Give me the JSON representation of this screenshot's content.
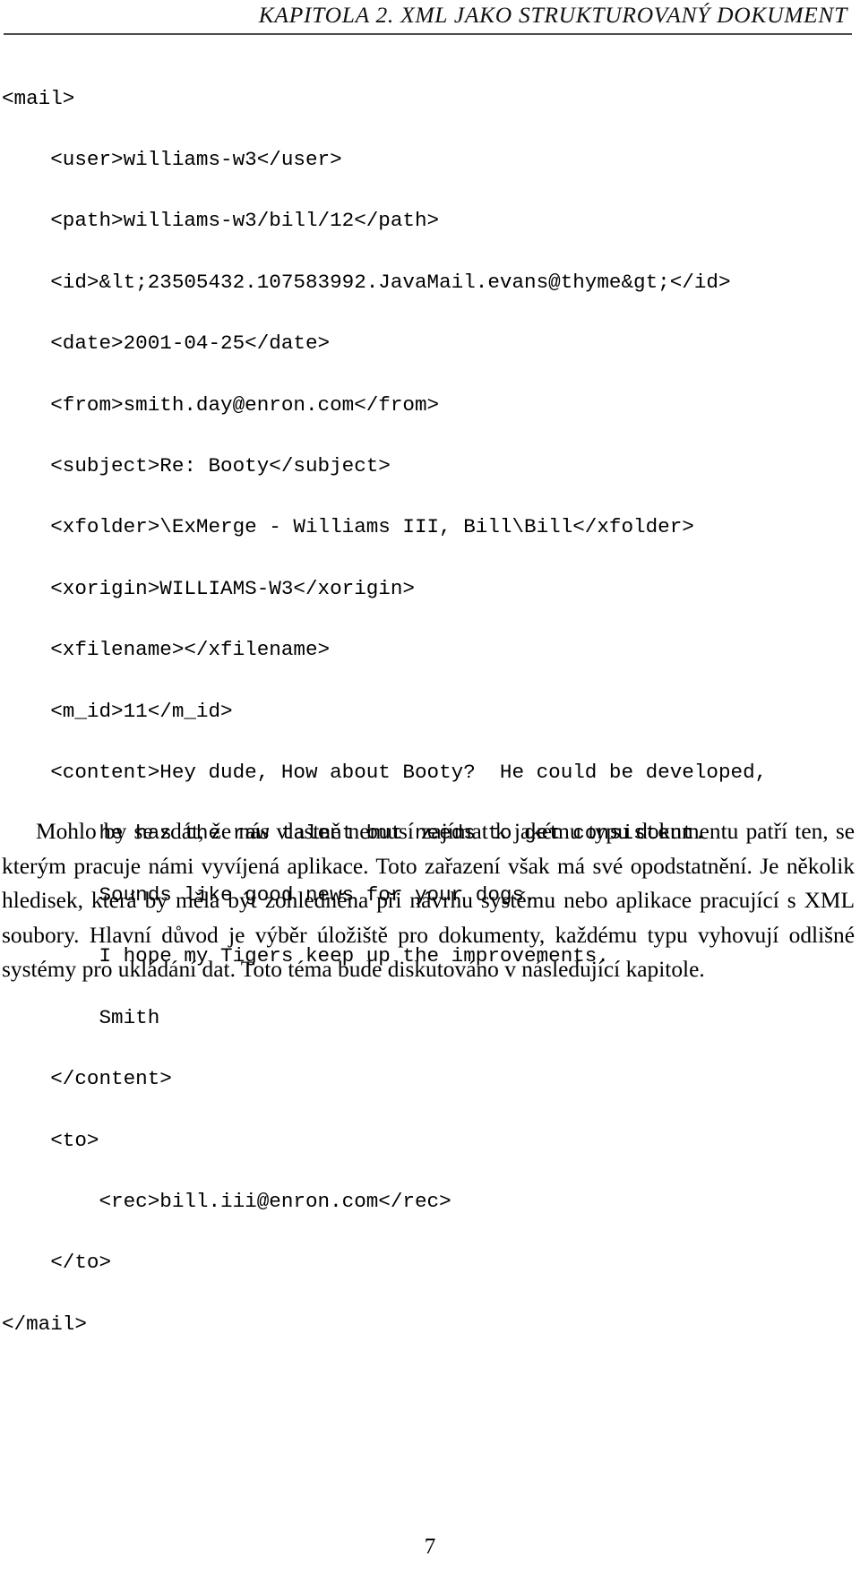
{
  "header": {
    "title": "KAPITOLA 2.  XML JAKO STRUKTUROVANÝ DOKUMENT"
  },
  "code_listing": {
    "language": "xml",
    "lines": [
      "<mail>",
      "    <user>williams-w3</user>",
      "    <path>williams-w3/bill/12</path>",
      "    <id>&lt;23505432.107583992.JavaMail.evans@thyme&gt;</id>",
      "    <date>2001-04-25</date>",
      "    <from>smith.day@enron.com</from>",
      "    <subject>Re: Booty</subject>",
      "    <xfolder>\\ExMerge - Williams III, Bill\\Bill</xfolder>",
      "    <xorigin>WILLIAMS-W3</xorigin>",
      "    <xfilename></xfilename>",
      "    <m_id>11</m_id>",
      "    <content>Hey dude, How about Booty?  He could be developed,",
      "        he has the raw talent but needs to get consistent.",
      "        Sounds like good news for your dogs.",
      "        I hope my Tigers keep up the improvements.",
      "        Smith",
      "    </content>",
      "    <to>",
      "        <rec>bill.iii@enron.com</rec>",
      "    </to>",
      "</mail>"
    ]
  },
  "body": {
    "paragraph": "Mohlo by se zdát, že nás vlastně nemusí zajímat k jakému typu dokumentu patří ten, se kterým pracuje námi vyvíjená aplikace. Toto zařazení však má své opodstatnění. Je několik hledisek, která by měla být zohledněna při návrhu systému nebo aplikace pracující s XML soubory. Hlavní důvod je výběr úložiště pro dokumenty, každému typu vyhovují odlišné systémy pro ukládání dat. Toto téma bude diskutováno v následující kapitole."
  },
  "footer": {
    "page_number": "7"
  }
}
